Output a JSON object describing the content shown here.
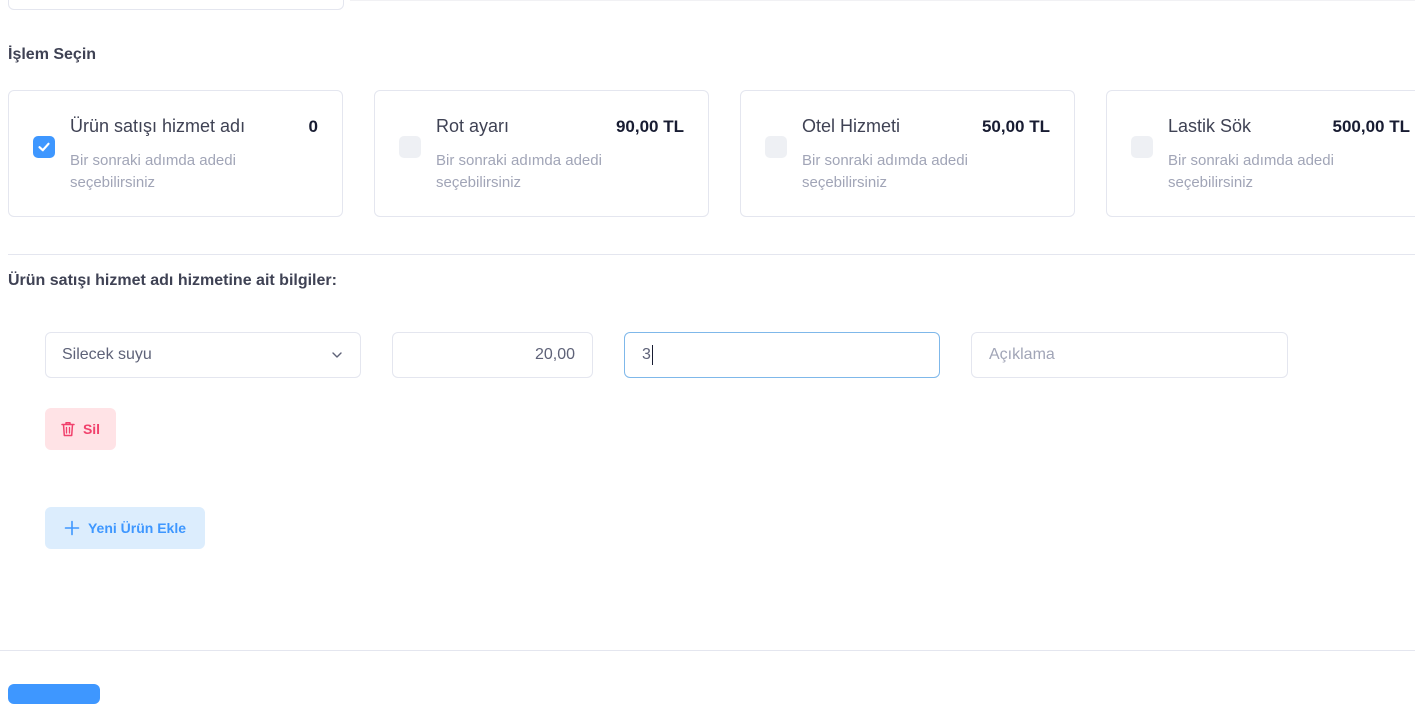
{
  "section_title": "İşlem Seçin",
  "services": [
    {
      "name": "Ürün satışı hizmet adı",
      "price": "0",
      "desc": "Bir sonraki adımda adedi seçebilirsiniz",
      "checked": true
    },
    {
      "name": "Rot ayarı",
      "price": "90,00 TL",
      "desc": "Bir sonraki adımda adedi seçebilirsiniz",
      "checked": false
    },
    {
      "name": "Otel Hizmeti",
      "price": "50,00 TL",
      "desc": "Bir sonraki adımda adedi seçebilirsiniz",
      "checked": false
    },
    {
      "name": "Lastik Sök",
      "price": "500,00 TL",
      "desc": "Bir sonraki adımda adedi seçebilirsiniz",
      "checked": false
    }
  ],
  "info_title": "Ürün satışı hizmet adı hizmetine ait bilgiler:",
  "product_row": {
    "product_selected": "Silecek suyu",
    "price_value": "20,00",
    "quantity_value": "3",
    "description_placeholder": "Açıklama",
    "delete_label": "Sil"
  },
  "add_product_label": "Yeni Ürün Ekle",
  "colors": {
    "primary": "#3e97ff",
    "danger": "#f1416c",
    "danger_light": "#ffe3e6",
    "primary_light": "#dcedfd"
  }
}
